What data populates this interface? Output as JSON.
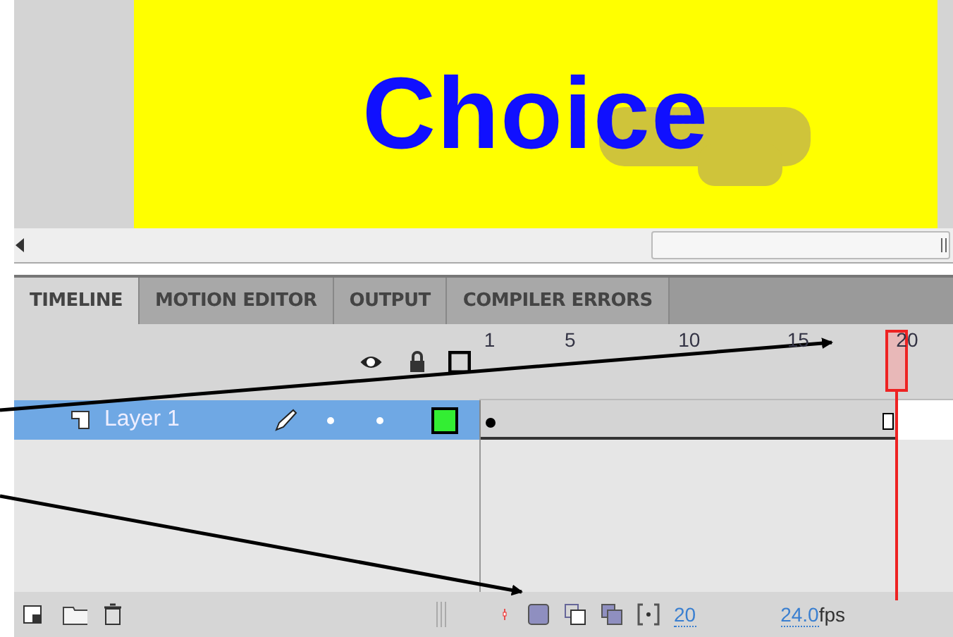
{
  "stage": {
    "text": "Choice"
  },
  "tabs": [
    {
      "label": "TIMELINE",
      "selected": true
    },
    {
      "label": "MOTION EDITOR",
      "selected": false
    },
    {
      "label": "OUTPUT",
      "selected": false
    },
    {
      "label": "COMPILER ERRORS",
      "selected": false
    }
  ],
  "ruler": {
    "frame_numbers": [
      "1",
      "5",
      "10",
      "15",
      "20"
    ]
  },
  "playhead": {
    "level": 0.88
  },
  "layers": [
    {
      "name": "Layer 1",
      "selected": true
    }
  ],
  "footer": {
    "current_frame": "20",
    "frame_rate": "24.0",
    "fps_unit": "fps"
  }
}
